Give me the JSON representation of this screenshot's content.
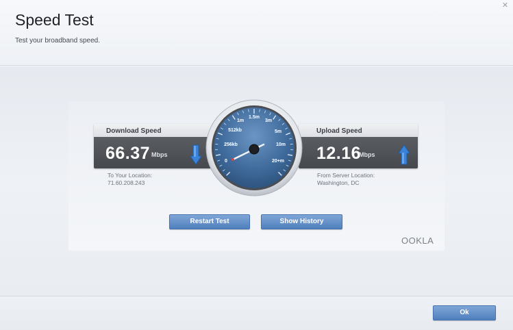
{
  "header": {
    "title": "Speed Test",
    "subtitle": "Test your broadband speed."
  },
  "close_icon": "close-icon",
  "download": {
    "label": "Download Speed",
    "value": "66.37",
    "unit": "Mbps",
    "location_label": "To Your Location:",
    "location_value": "71.60.208.243",
    "arrow_icon": "arrow-down-icon"
  },
  "upload": {
    "label": "Upload Speed",
    "value": "12.16",
    "unit": "Mbps",
    "location_label": "From Server Location:",
    "location_value": "Washington, DC",
    "arrow_icon": "arrow-up-icon"
  },
  "gauge": {
    "ticks": [
      "0",
      "256kb",
      "512kb",
      "1m",
      "1.5m",
      "3m",
      "5m",
      "10m",
      "20+m"
    ]
  },
  "buttons": {
    "restart": "Restart Test",
    "history": "Show History",
    "ok": "Ok"
  },
  "branding": "OOKLA",
  "colors": {
    "accent": "#5b8ac7",
    "arrow": "#3b83d9",
    "gauge_face": "#3f6b9c"
  }
}
